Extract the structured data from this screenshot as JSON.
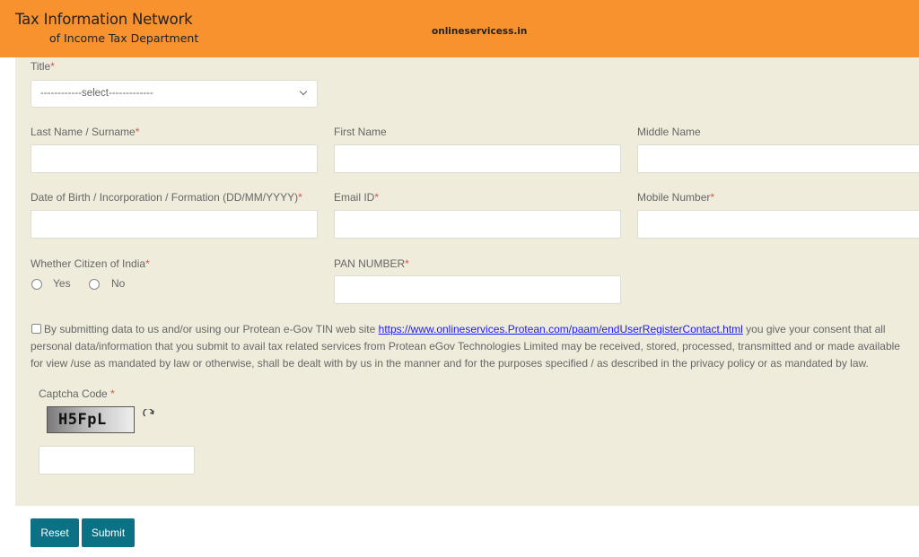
{
  "header": {
    "brand_line1": "Tax Information Network",
    "brand_line2": "of Income Tax Department",
    "site_name": "onlineservicess.in",
    "background_color": "#f7922e"
  },
  "form": {
    "title": {
      "label": "Title",
      "required_mark": "*",
      "selected": "------------select-------------"
    },
    "last_name": {
      "label": "Last Name / Surname",
      "required_mark": "*",
      "value": ""
    },
    "first_name": {
      "label": "First Name",
      "value": ""
    },
    "middle_name": {
      "label": "Middle Name",
      "value": ""
    },
    "dob": {
      "label": "Date of Birth / Incorporation / Formation (DD/MM/YYYY)",
      "required_mark": "*",
      "value": ""
    },
    "email": {
      "label": "Email ID",
      "required_mark": "*",
      "value": ""
    },
    "mobile": {
      "label": "Mobile Number",
      "required_mark": "*",
      "value": ""
    },
    "citizen": {
      "label": "Whether Citizen of India",
      "required_mark": "*",
      "options": [
        "Yes",
        "No"
      ]
    },
    "pan": {
      "label": "PAN NUMBER",
      "required_mark": "*",
      "value": ""
    },
    "consent": {
      "checked": false,
      "text_before": "By submitting data to us and/or using our Protean e-Gov TIN web site ",
      "link": "https://www.onlineservices.Protean.com/paam/endUserRegisterContact.html",
      "text_after": " you give your consent that all personal data/information that you submit to avail tax related services from Protean eGov Technologies Limited may be received, stored, processed, transmitted and or made available for view /use as mandated by law or otherwise, shall be dealt with by us in the manner and for the purposes specified / as described in the privacy policy or as mandated by law."
    },
    "captcha": {
      "label": "Captcha Code",
      "required_mark": "*",
      "code": "H5FpL",
      "value": ""
    }
  },
  "buttons": {
    "reset": "Reset",
    "submit": "Submit",
    "color": "#0b7285"
  }
}
